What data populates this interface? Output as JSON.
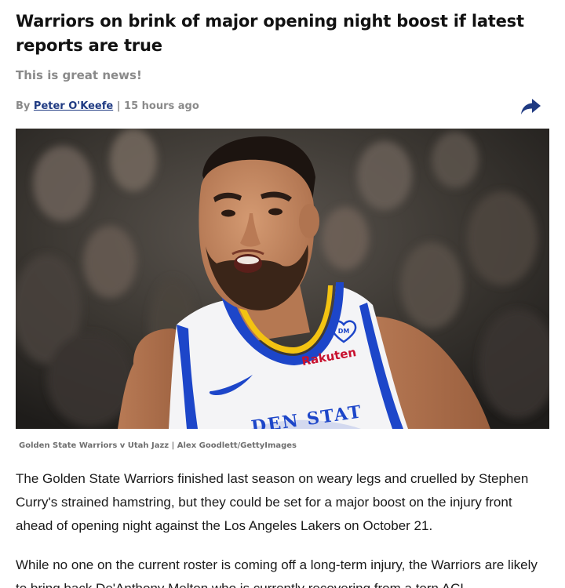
{
  "article": {
    "headline": "Warriors on brink of major opening night boost if latest reports are true",
    "subheadline": "This is great news!",
    "byline": {
      "prefix": "By ",
      "author": "Peter O'Keefe",
      "separator": " | ",
      "timestamp": "15 hours ago"
    },
    "share_icon": "share-arrow-icon",
    "image": {
      "jersey_text": "DEN STAT",
      "sponsor_text": "Rakuten",
      "badge_text": "DM"
    },
    "caption": "Golden State Warriors v Utah Jazz | Alex Goodlett/GettyImages",
    "paragraphs": [
      "The Golden State Warriors finished last season on weary legs and cruelled by Stephen Curry's strained hamstring, but they could be set for a major boost on the injury front ahead of opening night against the Los Angeles Lakers on October 21.",
      "While no one on the current roster is coming off a long-term injury, the Warriors are likely to bring back De'Anthony Melton who is currently recovering from a torn ACL"
    ]
  },
  "colors": {
    "headline": "#111111",
    "muted": "#8a8a8a",
    "author_link": "#1f3a82",
    "jersey_blue": "#1d46c9",
    "jersey_gold": "#f3c312",
    "sponsor_red": "#c8102e"
  }
}
